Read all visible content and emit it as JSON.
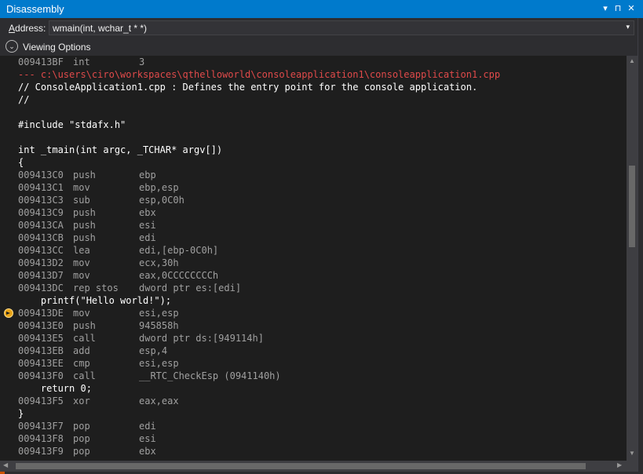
{
  "window": {
    "title": "Disassembly"
  },
  "titlebar_controls": {
    "dropdown_glyph": "▾",
    "pin_glyph": "⊓",
    "close_glyph": "✕"
  },
  "address": {
    "label_prefix": "A",
    "label_rest": "ddress:",
    "value": "wmain(int, wchar_t * *)",
    "dropdown_glyph": "▾"
  },
  "options": {
    "toggle_glyph": "⌄",
    "label": "Viewing Options"
  },
  "scroll_glyphs": {
    "up": "▲",
    "down": "▼",
    "left": "◀",
    "right": "▶"
  },
  "lines": [
    {
      "kind": "asm",
      "addr": "009413BF",
      "mnemonic": "int",
      "operands": "3"
    },
    {
      "kind": "path",
      "text": "--- c:\\users\\ciro\\workspaces\\qthelloworld\\consoleapplication1\\consoleapplication1.cpp"
    },
    {
      "kind": "src",
      "text": "// ConsoleApplication1.cpp : Defines the entry point for the console application."
    },
    {
      "kind": "src",
      "text": "//"
    },
    {
      "kind": "src",
      "text": ""
    },
    {
      "kind": "src",
      "text": "#include \"stdafx.h\""
    },
    {
      "kind": "src",
      "text": ""
    },
    {
      "kind": "src",
      "text": "int _tmain(int argc, _TCHAR* argv[])"
    },
    {
      "kind": "src",
      "text": "{"
    },
    {
      "kind": "asm",
      "addr": "009413C0",
      "mnemonic": "push",
      "operands": "ebp"
    },
    {
      "kind": "asm",
      "addr": "009413C1",
      "mnemonic": "mov",
      "operands": "ebp,esp"
    },
    {
      "kind": "asm",
      "addr": "009413C3",
      "mnemonic": "sub",
      "operands": "esp,0C0h"
    },
    {
      "kind": "asm",
      "addr": "009413C9",
      "mnemonic": "push",
      "operands": "ebx"
    },
    {
      "kind": "asm",
      "addr": "009413CA",
      "mnemonic": "push",
      "operands": "esi"
    },
    {
      "kind": "asm",
      "addr": "009413CB",
      "mnemonic": "push",
      "operands": "edi"
    },
    {
      "kind": "asm",
      "addr": "009413CC",
      "mnemonic": "lea",
      "operands": "edi,[ebp-0C0h]"
    },
    {
      "kind": "asm",
      "addr": "009413D2",
      "mnemonic": "mov",
      "operands": "ecx,30h"
    },
    {
      "kind": "asm",
      "addr": "009413D7",
      "mnemonic": "mov",
      "operands": "eax,0CCCCCCCCh"
    },
    {
      "kind": "asm",
      "addr": "009413DC",
      "mnemonic": "rep stos",
      "operands": "dword ptr es:[edi]"
    },
    {
      "kind": "src",
      "text": "    printf(\"Hello world!\");"
    },
    {
      "kind": "asm",
      "addr": "009413DE",
      "mnemonic": "mov",
      "operands": "esi,esp",
      "current": true
    },
    {
      "kind": "asm",
      "addr": "009413E0",
      "mnemonic": "push",
      "operands": "945858h"
    },
    {
      "kind": "asm",
      "addr": "009413E5",
      "mnemonic": "call",
      "operands": "dword ptr ds:[949114h]"
    },
    {
      "kind": "asm",
      "addr": "009413EB",
      "mnemonic": "add",
      "operands": "esp,4"
    },
    {
      "kind": "asm",
      "addr": "009413EE",
      "mnemonic": "cmp",
      "operands": "esi,esp"
    },
    {
      "kind": "asm",
      "addr": "009413F0",
      "mnemonic": "call",
      "operands": "__RTC_CheckEsp (0941140h)"
    },
    {
      "kind": "src",
      "text": "    return 0;"
    },
    {
      "kind": "asm",
      "addr": "009413F5",
      "mnemonic": "xor",
      "operands": "eax,eax"
    },
    {
      "kind": "src",
      "text": "}"
    },
    {
      "kind": "asm",
      "addr": "009413F7",
      "mnemonic": "pop",
      "operands": "edi"
    },
    {
      "kind": "asm",
      "addr": "009413F8",
      "mnemonic": "pop",
      "operands": "esi"
    },
    {
      "kind": "asm",
      "addr": "009413F9",
      "mnemonic": "pop",
      "operands": "ebx"
    }
  ]
}
